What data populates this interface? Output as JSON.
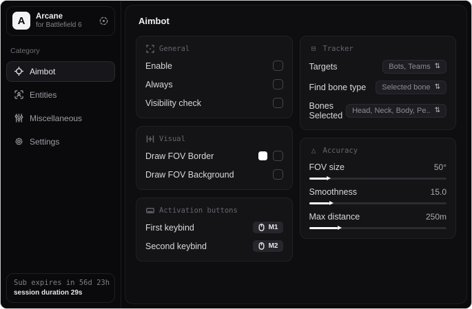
{
  "app": {
    "logo_letter": "A",
    "name": "Arcane",
    "subtitle": "for Battlefield 6"
  },
  "sidebar": {
    "category_label": "Category",
    "items": [
      {
        "label": "Aimbot",
        "icon": "crosshair-icon",
        "active": true
      },
      {
        "label": "Entities",
        "icon": "entities-icon",
        "active": false
      },
      {
        "label": "Miscellaneous",
        "icon": "sliders-icon",
        "active": false
      },
      {
        "label": "Settings",
        "icon": "gear-icon",
        "active": false
      }
    ],
    "footer": {
      "sub_expiry": "Sub expires in 56d 23h",
      "session_duration": "session duration 29s"
    }
  },
  "main": {
    "title": "Aimbot",
    "general": {
      "title": "General",
      "rows": [
        {
          "label": "Enable",
          "checked": false
        },
        {
          "label": "Always",
          "checked": false
        },
        {
          "label": "Visibility check",
          "checked": false
        }
      ]
    },
    "visual": {
      "title": "Visual",
      "rows": [
        {
          "label": "Draw FOV Border",
          "swatch_color": "#ffffff",
          "checked": false
        },
        {
          "label": "Draw FOV Background",
          "checked": false
        }
      ]
    },
    "activation": {
      "title": "Activation buttons",
      "rows": [
        {
          "label": "First keybind",
          "key": "M1"
        },
        {
          "label": "Second keybind",
          "key": "M2"
        }
      ]
    },
    "tracker": {
      "title": "Tracker",
      "rows": [
        {
          "label": "Targets",
          "value": "Bots, Teams"
        },
        {
          "label": "Find bone type",
          "value": "Selected bone"
        },
        {
          "label": "Bones Selected",
          "value": "Head, Neck, Body, Pe.."
        }
      ]
    },
    "accuracy": {
      "title": "Accuracy",
      "rows": [
        {
          "label": "FOV size",
          "value": "50°",
          "fill": 13
        },
        {
          "label": "Smoothness",
          "value": "15.0",
          "fill": 15
        },
        {
          "label": "Max distance",
          "value": "250m",
          "fill": 21
        }
      ]
    }
  },
  "colors": {
    "swatch": "#ffffff",
    "accent": "#ffffff"
  },
  "icons": {
    "unfold": "⇅",
    "tracker": "⊟",
    "accuracy": "△"
  }
}
